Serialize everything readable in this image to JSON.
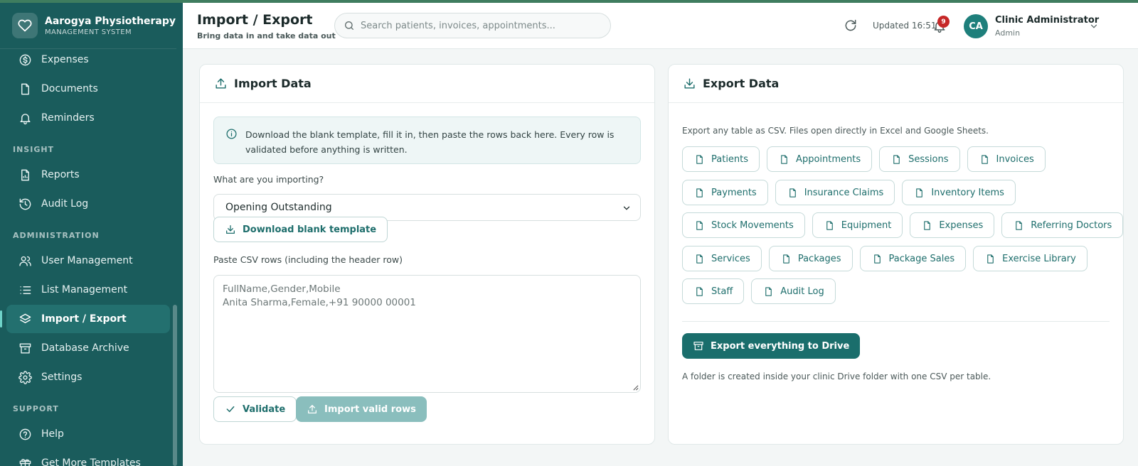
{
  "app": {
    "name": "Aarogya Physiotherapy & I",
    "subtitle": "MANAGEMENT SYSTEM"
  },
  "sidebar": {
    "items": [
      {
        "label": "Expenses",
        "icon": "dollar-circle-icon"
      },
      {
        "label": "Documents",
        "icon": "document-icon"
      },
      {
        "label": "Reminders",
        "icon": "bell-icon"
      }
    ],
    "sections": [
      {
        "title": "INSIGHT",
        "items": [
          {
            "label": "Reports",
            "icon": "report-icon"
          },
          {
            "label": "Audit Log",
            "icon": "history-icon"
          }
        ]
      },
      {
        "title": "ADMINISTRATION",
        "items": [
          {
            "label": "User Management",
            "icon": "users-icon"
          },
          {
            "label": "List Management",
            "icon": "list-icon"
          },
          {
            "label": "Import / Export",
            "icon": "layers-icon",
            "active": true
          },
          {
            "label": "Database Archive",
            "icon": "archive-icon"
          },
          {
            "label": "Settings",
            "icon": "gear-icon"
          }
        ]
      },
      {
        "title": "SUPPORT",
        "items": [
          {
            "label": "Help",
            "icon": "help-icon"
          },
          {
            "label": "Get More Templates",
            "icon": "gift-icon"
          }
        ]
      }
    ]
  },
  "header": {
    "title": "Import / Export",
    "subtitle": "Bring data in and take data out",
    "search_placeholder": "Search patients, invoices, appointments...",
    "updated": "Updated 16:51",
    "notification_count": "9",
    "user": {
      "initials": "CA",
      "name": "Clinic Administrator",
      "role": "Admin"
    }
  },
  "import_card": {
    "title": "Import Data",
    "info": "Download the blank template, fill it in, then paste the rows back here. Every row is validated before anything is written.",
    "type_label": "What are you importing?",
    "type_value": "Opening Outstanding",
    "download_label": "Download blank template",
    "paste_label": "Paste CSV rows (including the header row)",
    "paste_placeholder": "FullName,Gender,Mobile\nAnita Sharma,Female,+91 90000 00001",
    "validate_label": "Validate",
    "import_label": "Import valid rows"
  },
  "export_card": {
    "title": "Export Data",
    "description": "Export any table as CSV. Files open directly in Excel and Google Sheets.",
    "tables": [
      [
        "Patients",
        "Appointments",
        "Sessions",
        "Invoices"
      ],
      [
        "Payments",
        "Insurance Claims",
        "Inventory Items"
      ],
      [
        "Stock Movements",
        "Equipment",
        "Expenses",
        "Referring Doctors"
      ],
      [
        "Services",
        "Packages",
        "Package Sales",
        "Exercise Library"
      ],
      [
        "Staff",
        "Audit Log"
      ]
    ],
    "drive_label": "Export everything to Drive",
    "drive_note": "A folder is created inside your clinic Drive folder with one CSV per table."
  },
  "colors": {
    "sidebar": "#1a5c5c",
    "accent": "#1a6e6c",
    "badge": "#c62828"
  }
}
